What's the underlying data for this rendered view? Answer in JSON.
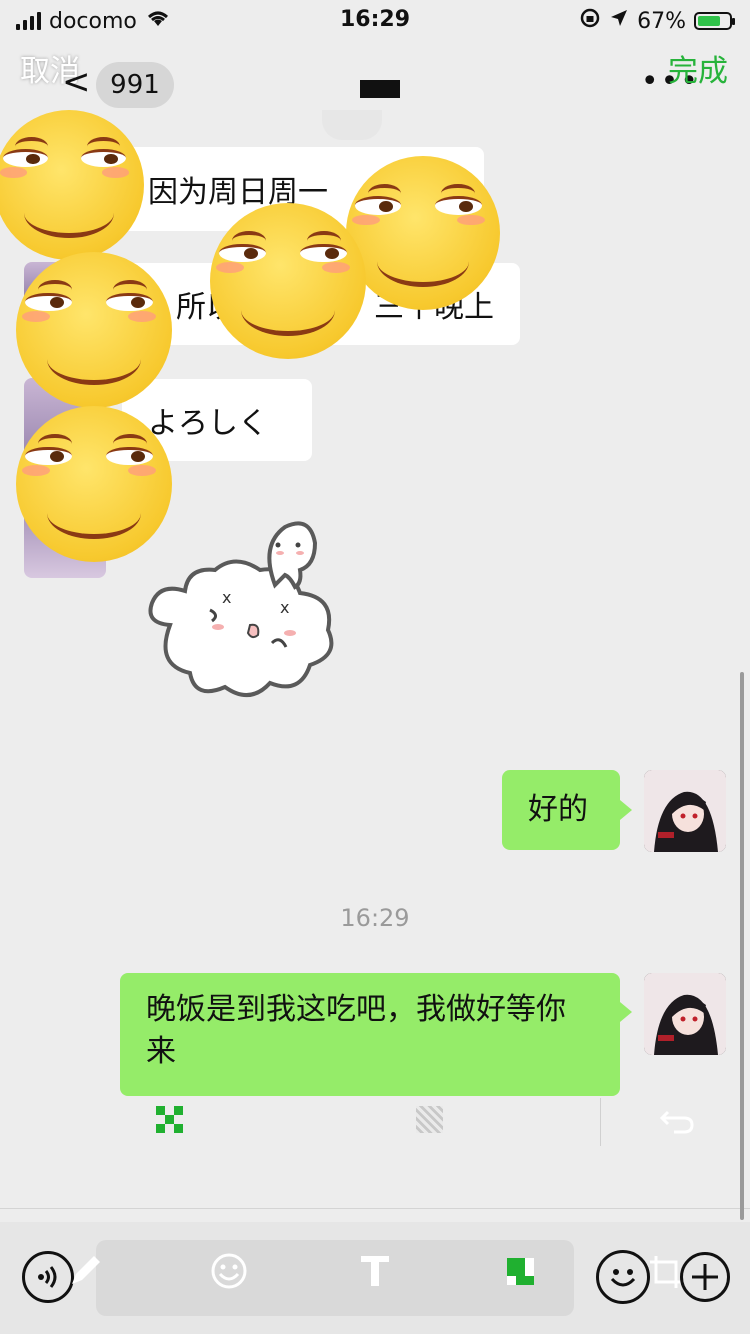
{
  "status_bar": {
    "carrier": "docomo",
    "time": "16:29",
    "battery": "67%"
  },
  "nav": {
    "cancel": "取消",
    "back": "<",
    "unread_count": "991",
    "done": "完成",
    "more": "•••"
  },
  "messages": {
    "m1": "因为周日周一everything",
    "m1_visible": "因为周日周一",
    "m2_left": "所以",
    "m2_right": "三个晚上",
    "m3": "よろしく",
    "m4": "好的",
    "timestamp": "16:29",
    "m5": "晚饭是到我这吃吧，我做好等你来"
  },
  "colors": {
    "green_bubble": "#95ec69",
    "accent": "#27b33b"
  },
  "edit_tools": [
    "mosaic-icon",
    "blur-icon",
    "undo-icon"
  ],
  "bottom_tools": [
    "voice-icon",
    "pen-icon",
    "emoji-icon",
    "text-icon",
    "mosaic-icon",
    "sticker-icon",
    "crop-icon",
    "add-icon"
  ]
}
